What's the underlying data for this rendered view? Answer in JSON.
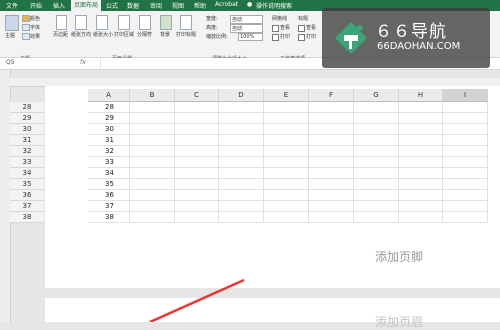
{
  "ribbon": {
    "tabs": [
      "文件",
      "开始",
      "插入",
      "页面布局",
      "公式",
      "数据",
      "审阅",
      "视图",
      "帮助",
      "Acrobat",
      "操作说明搜索"
    ],
    "active_tab_index": 3,
    "buttons": [
      "主题",
      "颜色",
      "字体",
      "效果",
      "页边距",
      "纸张方向",
      "纸张大小",
      "打印区域",
      "分隔符",
      "背景",
      "打印标题"
    ],
    "scale_labels": [
      "宽度:",
      "高度:",
      "缩放比例:"
    ],
    "scale_values": [
      "自动",
      "自动",
      "100%"
    ],
    "sheet_options": [
      "网格线",
      "标题",
      "查看",
      "打印"
    ],
    "groups": [
      "主题",
      "页面设置",
      "调整为合适大小",
      "工作表选项"
    ]
  },
  "formula_bar": {
    "name_box": "Q5",
    "fx": "fx"
  },
  "columns": [
    "A",
    "B",
    "C",
    "D",
    "E",
    "F",
    "G",
    "H",
    "I"
  ],
  "selected_column": "I",
  "rows": [
    {
      "num": "28",
      "a": "28"
    },
    {
      "num": "29",
      "a": "29"
    },
    {
      "num": "30",
      "a": "30"
    },
    {
      "num": "31",
      "a": "31"
    },
    {
      "num": "32",
      "a": "32"
    },
    {
      "num": "33",
      "a": "33"
    },
    {
      "num": "34",
      "a": "34"
    },
    {
      "num": "35",
      "a": "35"
    },
    {
      "num": "36",
      "a": "36"
    },
    {
      "num": "37",
      "a": "37"
    },
    {
      "num": "38",
      "a": "38"
    }
  ],
  "footer_text": "添加页脚",
  "header_text_next_page": "添加页眉",
  "watermark": {
    "title": "６６导航",
    "subtitle": "66DAOHAN.COM"
  },
  "colors": {
    "excel_green": "#217346",
    "annotation_red": "#e53935"
  }
}
